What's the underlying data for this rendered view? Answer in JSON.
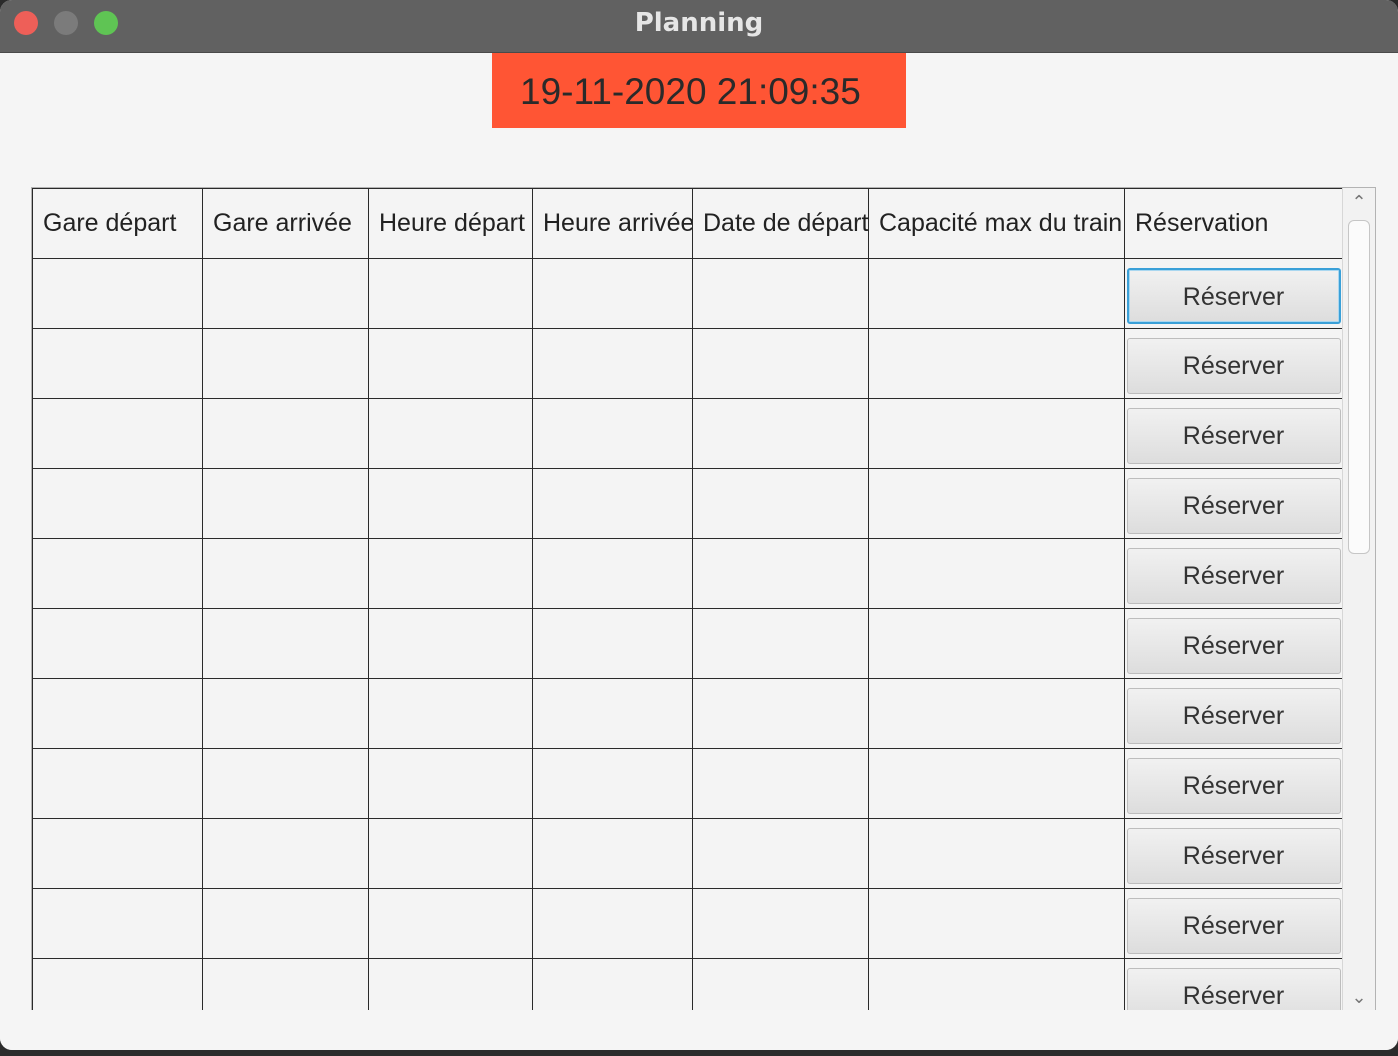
{
  "window": {
    "title": "Planning"
  },
  "clock": {
    "datetime": "19-11-2020 21:09:35",
    "bg_color": "#ff5534"
  },
  "table": {
    "headers": [
      "Gare départ",
      "Gare arrivée",
      "Heure départ",
      "Heure arrivée",
      "Date de départ",
      "Capacité max du train",
      "Réservation"
    ],
    "rows": [
      {
        "button": "Réserver"
      },
      {
        "button": "Réserver"
      },
      {
        "button": "Réserver"
      },
      {
        "button": "Réserver"
      },
      {
        "button": "Réserver"
      },
      {
        "button": "Réserver"
      },
      {
        "button": "Réserver"
      },
      {
        "button": "Réserver"
      },
      {
        "button": "Réserver"
      },
      {
        "button": "Réserver"
      },
      {
        "button": "Réserver"
      }
    ]
  },
  "scrollbar": {
    "up_icon": "chevron-up-icon",
    "down_icon": "chevron-down-icon"
  }
}
